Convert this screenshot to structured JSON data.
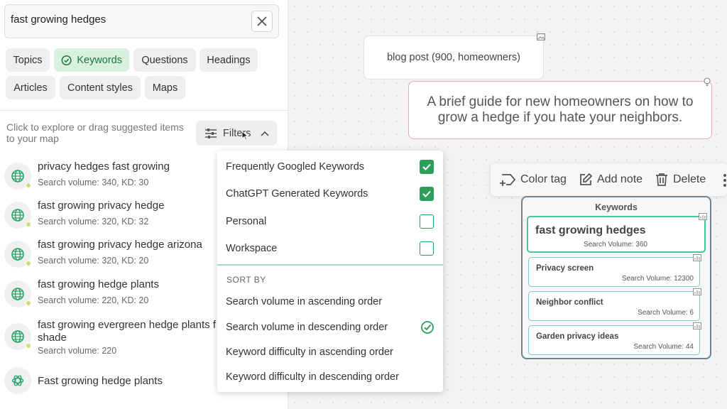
{
  "search": {
    "value": "fast growing hedges"
  },
  "chips": [
    "Topics",
    "Keywords",
    "Questions",
    "Headings",
    "Articles",
    "Content styles",
    "Maps"
  ],
  "hint": "Click to explore or drag suggested items to your map",
  "filters_label": "Filters",
  "results": [
    {
      "title": "privacy hedges fast growing",
      "sub": "Search volume: 340, KD: 30"
    },
    {
      "title": "fast growing privacy hedge",
      "sub": "Search volume: 320, KD: 32"
    },
    {
      "title": "fast growing privacy hedge arizona",
      "sub": "Search volume: 320, KD: 20"
    },
    {
      "title": "fast growing hedge plants",
      "sub": "Search volume: 220, KD: 20"
    },
    {
      "title": "fast growing evergreen hedge plants f",
      "title2": "shade",
      "sub": "Search volume: 220"
    },
    {
      "title": "Fast growing hedge plants"
    }
  ],
  "dropdown": {
    "sources": [
      {
        "label": "Frequently Googled Keywords",
        "checked": true
      },
      {
        "label": "ChatGPT Generated Keywords",
        "checked": true
      },
      {
        "label": "Personal",
        "checked": false
      },
      {
        "label": "Workspace",
        "checked": false
      }
    ],
    "sort_by_label": "SORT BY",
    "sort_options": [
      "Search volume in ascending order",
      "Search volume in descending order",
      "Keyword difficulty in ascending order",
      "Keyword difficulty in descending order"
    ],
    "selected_sort": 1
  },
  "canvas": {
    "blog_node": "blog post (900, homeowners)",
    "guide_node": "A brief guide for new homeowners on how to grow a hedge if you hate your neighbors.",
    "toolbar": {
      "color_tag": "Color tag",
      "add_note": "Add note",
      "delete": "Delete"
    },
    "keywords_group": {
      "title": "Keywords",
      "cards": [
        {
          "name": "fast growing hedges",
          "volume": "Search Volume: 360"
        },
        {
          "name": "Privacy screen",
          "volume": "Search Volume: 12300"
        },
        {
          "name": "Neighbor conflict",
          "volume": "Search Volume: 6"
        },
        {
          "name": "Garden privacy ideas",
          "volume": "Search Volume: 44"
        }
      ]
    }
  },
  "colors": {
    "accent_green": "#2e9e5b",
    "chip_active_bg": "#d8f0de",
    "guide_border": "#f0a8b6",
    "kw_border": "#7dc9d6"
  }
}
